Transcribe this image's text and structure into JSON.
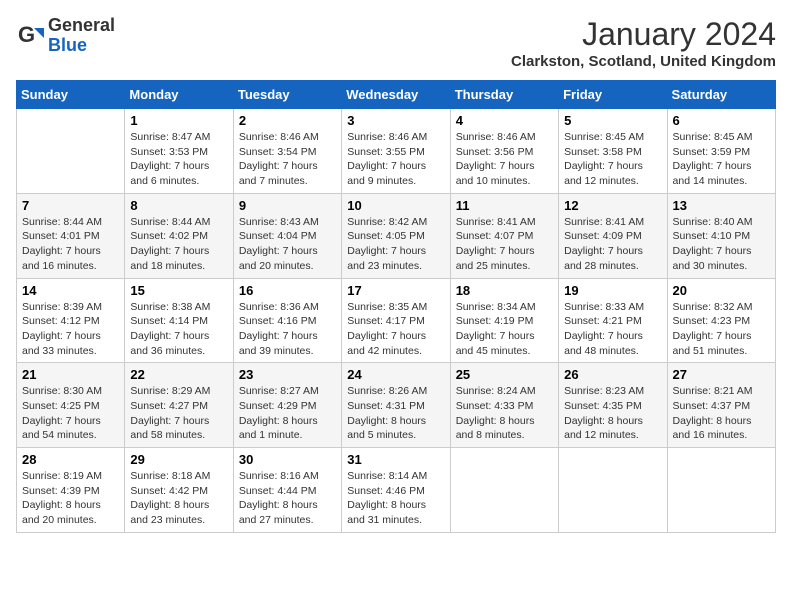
{
  "header": {
    "logo_general": "General",
    "logo_blue": "Blue",
    "month_title": "January 2024",
    "location": "Clarkston, Scotland, United Kingdom"
  },
  "weekdays": [
    "Sunday",
    "Monday",
    "Tuesday",
    "Wednesday",
    "Thursday",
    "Friday",
    "Saturday"
  ],
  "weeks": [
    [
      {
        "day": "",
        "info": ""
      },
      {
        "day": "1",
        "info": "Sunrise: 8:47 AM\nSunset: 3:53 PM\nDaylight: 7 hours\nand 6 minutes."
      },
      {
        "day": "2",
        "info": "Sunrise: 8:46 AM\nSunset: 3:54 PM\nDaylight: 7 hours\nand 7 minutes."
      },
      {
        "day": "3",
        "info": "Sunrise: 8:46 AM\nSunset: 3:55 PM\nDaylight: 7 hours\nand 9 minutes."
      },
      {
        "day": "4",
        "info": "Sunrise: 8:46 AM\nSunset: 3:56 PM\nDaylight: 7 hours\nand 10 minutes."
      },
      {
        "day": "5",
        "info": "Sunrise: 8:45 AM\nSunset: 3:58 PM\nDaylight: 7 hours\nand 12 minutes."
      },
      {
        "day": "6",
        "info": "Sunrise: 8:45 AM\nSunset: 3:59 PM\nDaylight: 7 hours\nand 14 minutes."
      }
    ],
    [
      {
        "day": "7",
        "info": "Sunrise: 8:44 AM\nSunset: 4:01 PM\nDaylight: 7 hours\nand 16 minutes."
      },
      {
        "day": "8",
        "info": "Sunrise: 8:44 AM\nSunset: 4:02 PM\nDaylight: 7 hours\nand 18 minutes."
      },
      {
        "day": "9",
        "info": "Sunrise: 8:43 AM\nSunset: 4:04 PM\nDaylight: 7 hours\nand 20 minutes."
      },
      {
        "day": "10",
        "info": "Sunrise: 8:42 AM\nSunset: 4:05 PM\nDaylight: 7 hours\nand 23 minutes."
      },
      {
        "day": "11",
        "info": "Sunrise: 8:41 AM\nSunset: 4:07 PM\nDaylight: 7 hours\nand 25 minutes."
      },
      {
        "day": "12",
        "info": "Sunrise: 8:41 AM\nSunset: 4:09 PM\nDaylight: 7 hours\nand 28 minutes."
      },
      {
        "day": "13",
        "info": "Sunrise: 8:40 AM\nSunset: 4:10 PM\nDaylight: 7 hours\nand 30 minutes."
      }
    ],
    [
      {
        "day": "14",
        "info": "Sunrise: 8:39 AM\nSunset: 4:12 PM\nDaylight: 7 hours\nand 33 minutes."
      },
      {
        "day": "15",
        "info": "Sunrise: 8:38 AM\nSunset: 4:14 PM\nDaylight: 7 hours\nand 36 minutes."
      },
      {
        "day": "16",
        "info": "Sunrise: 8:36 AM\nSunset: 4:16 PM\nDaylight: 7 hours\nand 39 minutes."
      },
      {
        "day": "17",
        "info": "Sunrise: 8:35 AM\nSunset: 4:17 PM\nDaylight: 7 hours\nand 42 minutes."
      },
      {
        "day": "18",
        "info": "Sunrise: 8:34 AM\nSunset: 4:19 PM\nDaylight: 7 hours\nand 45 minutes."
      },
      {
        "day": "19",
        "info": "Sunrise: 8:33 AM\nSunset: 4:21 PM\nDaylight: 7 hours\nand 48 minutes."
      },
      {
        "day": "20",
        "info": "Sunrise: 8:32 AM\nSunset: 4:23 PM\nDaylight: 7 hours\nand 51 minutes."
      }
    ],
    [
      {
        "day": "21",
        "info": "Sunrise: 8:30 AM\nSunset: 4:25 PM\nDaylight: 7 hours\nand 54 minutes."
      },
      {
        "day": "22",
        "info": "Sunrise: 8:29 AM\nSunset: 4:27 PM\nDaylight: 7 hours\nand 58 minutes."
      },
      {
        "day": "23",
        "info": "Sunrise: 8:27 AM\nSunset: 4:29 PM\nDaylight: 8 hours\nand 1 minute."
      },
      {
        "day": "24",
        "info": "Sunrise: 8:26 AM\nSunset: 4:31 PM\nDaylight: 8 hours\nand 5 minutes."
      },
      {
        "day": "25",
        "info": "Sunrise: 8:24 AM\nSunset: 4:33 PM\nDaylight: 8 hours\nand 8 minutes."
      },
      {
        "day": "26",
        "info": "Sunrise: 8:23 AM\nSunset: 4:35 PM\nDaylight: 8 hours\nand 12 minutes."
      },
      {
        "day": "27",
        "info": "Sunrise: 8:21 AM\nSunset: 4:37 PM\nDaylight: 8 hours\nand 16 minutes."
      }
    ],
    [
      {
        "day": "28",
        "info": "Sunrise: 8:19 AM\nSunset: 4:39 PM\nDaylight: 8 hours\nand 20 minutes."
      },
      {
        "day": "29",
        "info": "Sunrise: 8:18 AM\nSunset: 4:42 PM\nDaylight: 8 hours\nand 23 minutes."
      },
      {
        "day": "30",
        "info": "Sunrise: 8:16 AM\nSunset: 4:44 PM\nDaylight: 8 hours\nand 27 minutes."
      },
      {
        "day": "31",
        "info": "Sunrise: 8:14 AM\nSunset: 4:46 PM\nDaylight: 8 hours\nand 31 minutes."
      },
      {
        "day": "",
        "info": ""
      },
      {
        "day": "",
        "info": ""
      },
      {
        "day": "",
        "info": ""
      }
    ]
  ]
}
